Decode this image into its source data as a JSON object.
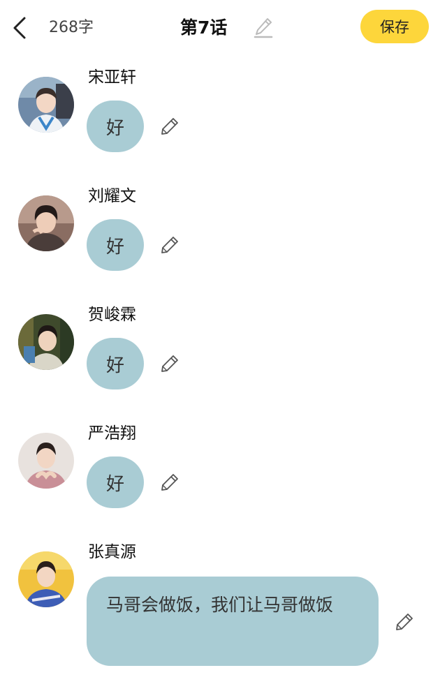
{
  "header": {
    "word_count": "268字",
    "title": "第7话",
    "save_label": "保存"
  },
  "messages": [
    {
      "name": "宋亚轩",
      "text": "好"
    },
    {
      "name": "刘耀文",
      "text": "好"
    },
    {
      "name": "贺峻霖",
      "text": "好"
    },
    {
      "name": "严浩翔",
      "text": "好"
    },
    {
      "name": "张真源",
      "text": "马哥会做饭，我们让马哥做饭"
    }
  ],
  "colors": {
    "accent": "#fdd63b",
    "bubble": "#a9ccd4"
  },
  "icons": {
    "back": "chevron-left-icon",
    "edit": "pencil-icon"
  }
}
